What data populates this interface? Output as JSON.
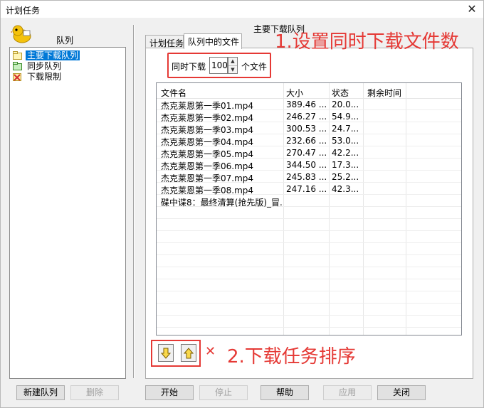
{
  "window": {
    "title": "计划任务",
    "close_glyph": "✕"
  },
  "left": {
    "title": "队列",
    "items": [
      {
        "label": "主要下载队列",
        "icon": "queue-folder-icon",
        "selected": true
      },
      {
        "label": "同步队列",
        "icon": "queue-folder-icon",
        "selected": false
      },
      {
        "label": "下载限制",
        "icon": "limit-x-icon",
        "selected": false
      }
    ],
    "new_button": "新建队列",
    "delete_button": "删除"
  },
  "right": {
    "queue_name": "主要下载队列",
    "tabs": [
      {
        "label": "计划任务",
        "active": false
      },
      {
        "label": "队列中的文件",
        "active": true
      }
    ],
    "simultaneous": {
      "label": "同时下载",
      "value": "100",
      "unit": "个文件"
    },
    "columns": [
      "文件名",
      "大小",
      "状态",
      "剩余时间"
    ],
    "rows": [
      {
        "name": "杰克莱恩第一季01.mp4",
        "size": "389.46 ...",
        "status": "20.0...",
        "remaining": ""
      },
      {
        "name": "杰克莱恩第一季02.mp4",
        "size": "246.27 ...",
        "status": "54.9...",
        "remaining": ""
      },
      {
        "name": "杰克莱恩第一季03.mp4",
        "size": "300.53 ...",
        "status": "24.7...",
        "remaining": ""
      },
      {
        "name": "杰克莱恩第一季04.mp4",
        "size": "232.66 ...",
        "status": "53.0...",
        "remaining": ""
      },
      {
        "name": "杰克莱恩第一季05.mp4",
        "size": "270.47 ...",
        "status": "42.2...",
        "remaining": ""
      },
      {
        "name": "杰克莱恩第一季06.mp4",
        "size": "344.50 ...",
        "status": "17.3...",
        "remaining": ""
      },
      {
        "name": "杰克莱恩第一季07.mp4",
        "size": "245.83 ...",
        "status": "25.2...",
        "remaining": ""
      },
      {
        "name": "杰克莱恩第一季08.mp4",
        "size": "247.16 ...",
        "status": "42.3...",
        "remaining": ""
      },
      {
        "name": "碟中谍8：最终清算(抢先版)_冒...",
        "size": "",
        "status": "",
        "remaining": ""
      }
    ],
    "delete_glyph": "✕"
  },
  "annotations": {
    "step1": "1.设置同时下载文件数",
    "step2": "2.下载任务排序"
  },
  "buttons": {
    "start": "开始",
    "stop": "停止",
    "help": "帮助",
    "apply": "应用",
    "close": "关闭"
  },
  "colors": {
    "highlight": "#e53935",
    "selection": "#0078d7"
  }
}
